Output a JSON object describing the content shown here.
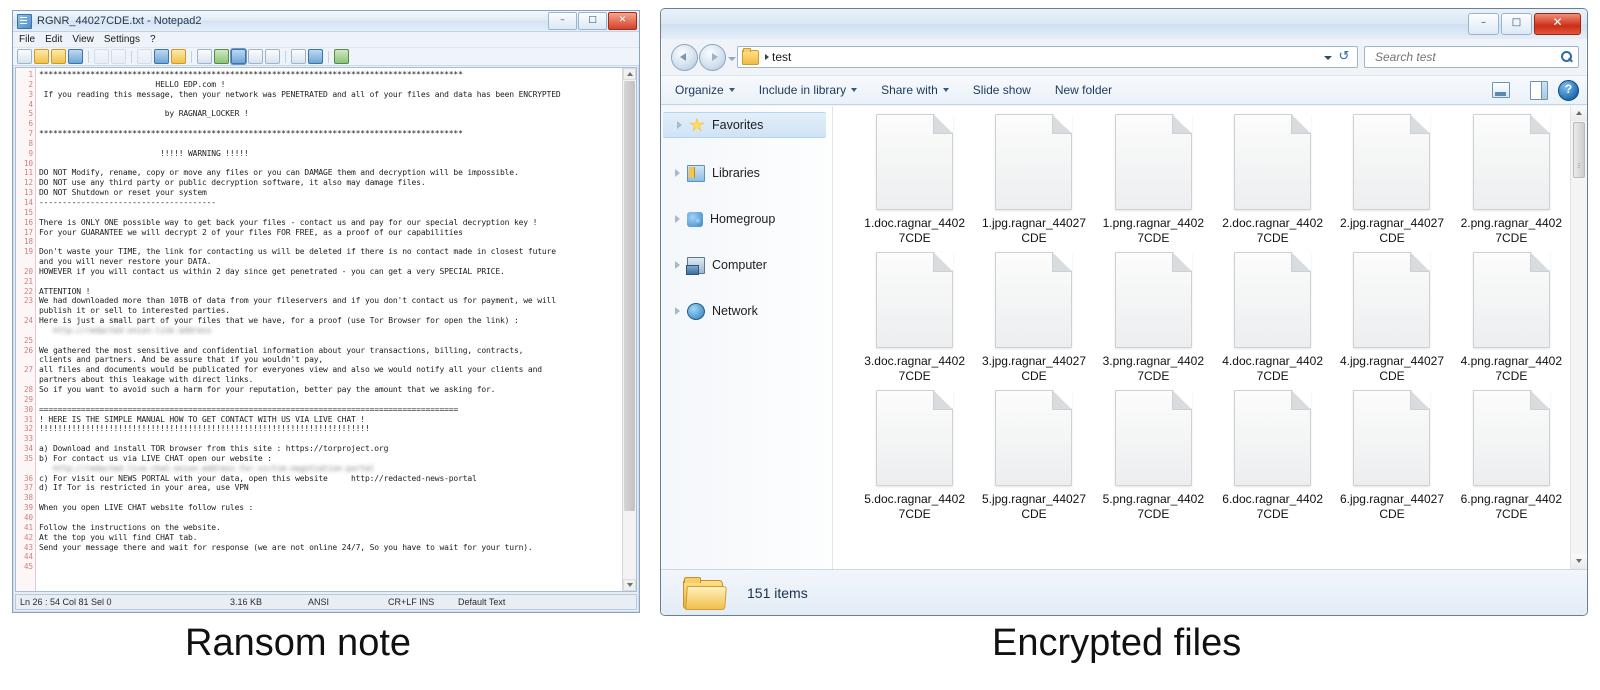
{
  "notepad": {
    "title": "RGNR_44027CDE.txt - Notepad2",
    "title_icon": "notepad-document-icon",
    "window_buttons": [
      {
        "name": "minimize",
        "glyph": "–"
      },
      {
        "name": "maximize",
        "glyph": "□"
      },
      {
        "name": "close",
        "glyph": "✕"
      }
    ],
    "menu": [
      "File",
      "Edit",
      "View",
      "Settings",
      "?"
    ],
    "toolbar_icons": [
      "new-file-icon",
      "open-file-icon",
      "reload-file-icon",
      "save-file-icon",
      "undo-icon",
      "redo-icon",
      "cut-icon",
      "copy-icon",
      "paste-icon",
      "find-icon",
      "replace-icon",
      "word-wrap-icon",
      "zoom-in-icon",
      "zoom-out-icon",
      "scheme-icon",
      "favorites-icon",
      "exit-icon"
    ],
    "lines": [
      {
        "n": 1,
        "text": "*******************************************************************************************",
        "blur": false
      },
      {
        "n": 2,
        "text": "                         HELLO EDP.com !",
        "blur": false
      },
      {
        "n": 3,
        "text": " If you reading this message, then your network was PENETRATED and all of your files and data has been ENCRYPTED",
        "blur": false
      },
      {
        "n": 4,
        "text": "",
        "blur": false
      },
      {
        "n": 5,
        "text": "                           by RAGNAR_LOCKER !",
        "blur": false
      },
      {
        "n": 6,
        "text": "",
        "blur": false
      },
      {
        "n": 7,
        "text": "*******************************************************************************************",
        "blur": false
      },
      {
        "n": 8,
        "text": "",
        "blur": false
      },
      {
        "n": 9,
        "text": "                          !!!!! WARNING !!!!!",
        "blur": false
      },
      {
        "n": 10,
        "text": "",
        "blur": false
      },
      {
        "n": 11,
        "text": "DO NOT Modify, rename, copy or move any files or you can DAMAGE them and decryption will be impossible.",
        "blur": false
      },
      {
        "n": 12,
        "text": "DO NOT use any third party or public decryption software, it also may damage files.",
        "blur": false
      },
      {
        "n": 13,
        "text": "DO NOT Shutdown or reset your system",
        "blur": false
      },
      {
        "n": 14,
        "text": "--------------------------------------",
        "blur": false
      },
      {
        "n": 15,
        "text": "",
        "blur": false
      },
      {
        "n": 16,
        "text": "There is ONLY ONE possible way to get back your files - contact us and pay for our special decryption key !",
        "blur": false
      },
      {
        "n": 17,
        "text": "For your GUARANTEE we will decrypt 2 of your files FOR FREE, as a proof of our capabilities",
        "blur": false
      },
      {
        "n": 18,
        "text": "",
        "blur": false
      },
      {
        "n": 19,
        "text": "Don't waste your TIME, the link for contacting us will be deleted if there is no contact made in closest future",
        "blur": false
      },
      {
        "n": "",
        "text": "and you will never restore your DATA.",
        "blur": false
      },
      {
        "n": 20,
        "text": "HOWEVER if you will contact us within 2 day since get penetrated - you can get a very SPECIAL PRICE.",
        "blur": false
      },
      {
        "n": 21,
        "text": "",
        "blur": false
      },
      {
        "n": 22,
        "text": "ATTENTION !",
        "blur": false
      },
      {
        "n": 23,
        "text": "We had downloaded more than 10TB of data from your fileservers and if you don't contact us for payment, we will",
        "blur": false
      },
      {
        "n": "",
        "text": "publish it or sell to interested parties.",
        "blur": false
      },
      {
        "n": 24,
        "text": "Here is just a small part of your files that we have, for a proof (use Tor Browser for open the link) :",
        "blur": false
      },
      {
        "n": "",
        "text": "   http://redacted-onion-link-address",
        "blur": true
      },
      {
        "n": 25,
        "text": "",
        "blur": false
      },
      {
        "n": 26,
        "text": "We gathered the most sensitive and confidential information about your transactions, billing, contracts,",
        "blur": false
      },
      {
        "n": "",
        "text": "clients and partners. And be assure that if you wouldn't pay,",
        "blur": false
      },
      {
        "n": 27,
        "text": "all files and documents would be publicated for everyones view and also we would notify all your clients and",
        "blur": false
      },
      {
        "n": "",
        "text": "partners about this leakage with direct links.",
        "blur": false
      },
      {
        "n": 28,
        "text": "So if you want to avoid such a harm for your reputation, better pay the amount that we asking for.",
        "blur": false
      },
      {
        "n": 29,
        "text": "",
        "blur": false
      },
      {
        "n": 30,
        "text": "==========================================================================================",
        "blur": false
      },
      {
        "n": 31,
        "text": "! HERE IS THE SIMPLE MANUAL HOW TO GET CONTACT WITH US VIA LIVE CHAT !",
        "blur": false
      },
      {
        "n": 32,
        "text": "!!!!!!!!!!!!!!!!!!!!!!!!!!!!!!!!!!!!!!!!!!!!!!!!!!!!!!!!!!!!!!!!!!!!!!!",
        "blur": false
      },
      {
        "n": 33,
        "text": "",
        "blur": false
      },
      {
        "n": 34,
        "text": "a) Download and install TOR browser from this site : https://torproject.org",
        "blur": false
      },
      {
        "n": 35,
        "text": "b) For contact us via LIVE CHAT open our website :",
        "blur": false
      },
      {
        "n": "",
        "text": "   http://redacted-live-chat-onion-address-for-victim-negotiation-portal",
        "blur": true
      },
      {
        "n": 36,
        "text": "c) For visit our NEWS PORTAL with your data, open this website     http://redacted-news-portal",
        "blur": false
      },
      {
        "n": 37,
        "text": "d) If Tor is restricted in your area, use VPN",
        "blur": false
      },
      {
        "n": 38,
        "text": "",
        "blur": false
      },
      {
        "n": 39,
        "text": "When you open LIVE CHAT website follow rules :",
        "blur": false
      },
      {
        "n": 40,
        "text": "",
        "blur": false
      },
      {
        "n": 41,
        "text": "Follow the instructions on the website.",
        "blur": false
      },
      {
        "n": 42,
        "text": "At the top you will find CHAT tab.",
        "blur": false
      },
      {
        "n": 43,
        "text": "Send your message there and wait for response (we are not online 24/7, So you have to wait for your turn).",
        "blur": false
      },
      {
        "n": 44,
        "text": "",
        "blur": false
      },
      {
        "n": 45,
        "text": "",
        "blur": false
      }
    ],
    "status": {
      "position": "Ln 26 : 54   Col 81   Sel 0",
      "size": "3.16 KB",
      "encoding": "ANSI",
      "line_endings": "CR+LF  INS",
      "scheme": "Default Text"
    }
  },
  "explorer": {
    "window_buttons": [
      {
        "name": "minimize",
        "glyph": "–"
      },
      {
        "name": "maximize",
        "glyph": "□"
      },
      {
        "name": "close",
        "glyph": "✕"
      }
    ],
    "address": {
      "folder_icon": "folder-icon",
      "crumb": "test",
      "dropdown_icon": "chevron-down-icon",
      "refresh_icon": "refresh-icon"
    },
    "search": {
      "placeholder": "Search test",
      "icon": "search-icon"
    },
    "toolbar": [
      {
        "label": "Organize",
        "caret": true
      },
      {
        "label": "Include in library",
        "caret": true
      },
      {
        "label": "Share with",
        "caret": true
      },
      {
        "label": "Slide show",
        "caret": false
      },
      {
        "label": "New folder",
        "caret": false
      }
    ],
    "toolbar_right": [
      "change-view-icon",
      "view-caret-icon",
      "preview-pane-icon",
      "help-icon"
    ],
    "sidebar": [
      {
        "label": "Favorites",
        "icon": "star-icon",
        "selected": true
      },
      {
        "label": "Libraries",
        "icon": "library-icon",
        "selected": false
      },
      {
        "label": "Homegroup",
        "icon": "homegroup-icon",
        "selected": false
      },
      {
        "label": "Computer",
        "icon": "computer-icon",
        "selected": false
      },
      {
        "label": "Network",
        "icon": "network-icon",
        "selected": false
      }
    ],
    "files": [
      "1.doc.ragnar_44027CDE",
      "1.jpg.ragnar_44027CDE",
      "1.png.ragnar_44027CDE",
      "2.doc.ragnar_44027CDE",
      "2.jpg.ragnar_44027CDE",
      "2.png.ragnar_44027CDE",
      "3.doc.ragnar_44027CDE",
      "3.jpg.ragnar_44027CDE",
      "3.png.ragnar_44027CDE",
      "4.doc.ragnar_44027CDE",
      "4.jpg.ragnar_44027CDE",
      "4.png.ragnar_44027CDE",
      "5.doc.ragnar_44027CDE",
      "5.jpg.ragnar_44027CDE",
      "5.png.ragnar_44027CDE",
      "6.doc.ragnar_44027CDE",
      "6.jpg.ragnar_44027CDE",
      "6.png.ragnar_44027CDE"
    ],
    "status": {
      "icon": "folder-icon",
      "item_count": "151 items"
    }
  },
  "captions": {
    "left": "Ransom note",
    "right": "Encrypted files"
  },
  "colors": {
    "accent_blue": "#2f6aa8",
    "close_red": "#cd2d17",
    "gutter_red": "#d27e7e",
    "folder_yellow": "#f0c14b"
  }
}
